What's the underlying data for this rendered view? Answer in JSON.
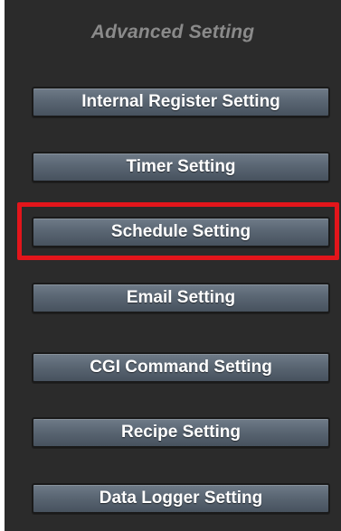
{
  "panel": {
    "title": "Advanced Setting"
  },
  "buttons": [
    {
      "label": "Internal Register Setting"
    },
    {
      "label": "Timer Setting"
    },
    {
      "label": "Schedule Setting",
      "highlighted": true
    },
    {
      "label": "Email Setting"
    },
    {
      "label": "CGI Command Setting"
    },
    {
      "label": "Recipe Setting"
    },
    {
      "label": "Data Logger Setting"
    }
  ],
  "colors": {
    "panel_background": "#2b2b2b",
    "title_text": "#8a8a8a",
    "button_background": "#5a6673",
    "button_text": "#ffffff",
    "highlight_border": "#e3151b"
  }
}
